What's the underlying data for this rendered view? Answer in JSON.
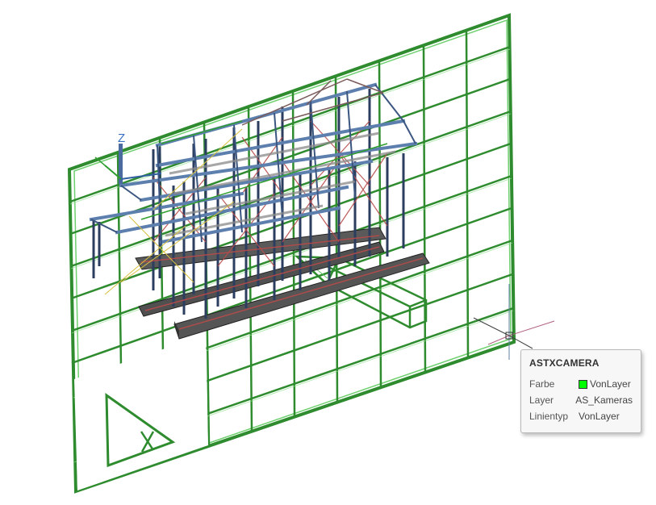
{
  "ucs": {
    "z_label": "Z"
  },
  "tooltip": {
    "title": "ASTXCAMERA",
    "rows": [
      {
        "key": "Farbe",
        "value": "VonLayer",
        "swatch": "#00ff00"
      },
      {
        "key": "Layer",
        "value": "AS_Kameras"
      },
      {
        "key": "Linientyp",
        "value": "VonLayer"
      }
    ]
  },
  "colors": {
    "frame_green": "#2e8b2e",
    "frame_green_light": "#5fc05f",
    "steel_blue": "#4a6a9a",
    "steel_dark": "#2c3e5f",
    "brace_red": "#b84a4a",
    "slab_gray": "#555555",
    "crosshair": "#b06080"
  }
}
